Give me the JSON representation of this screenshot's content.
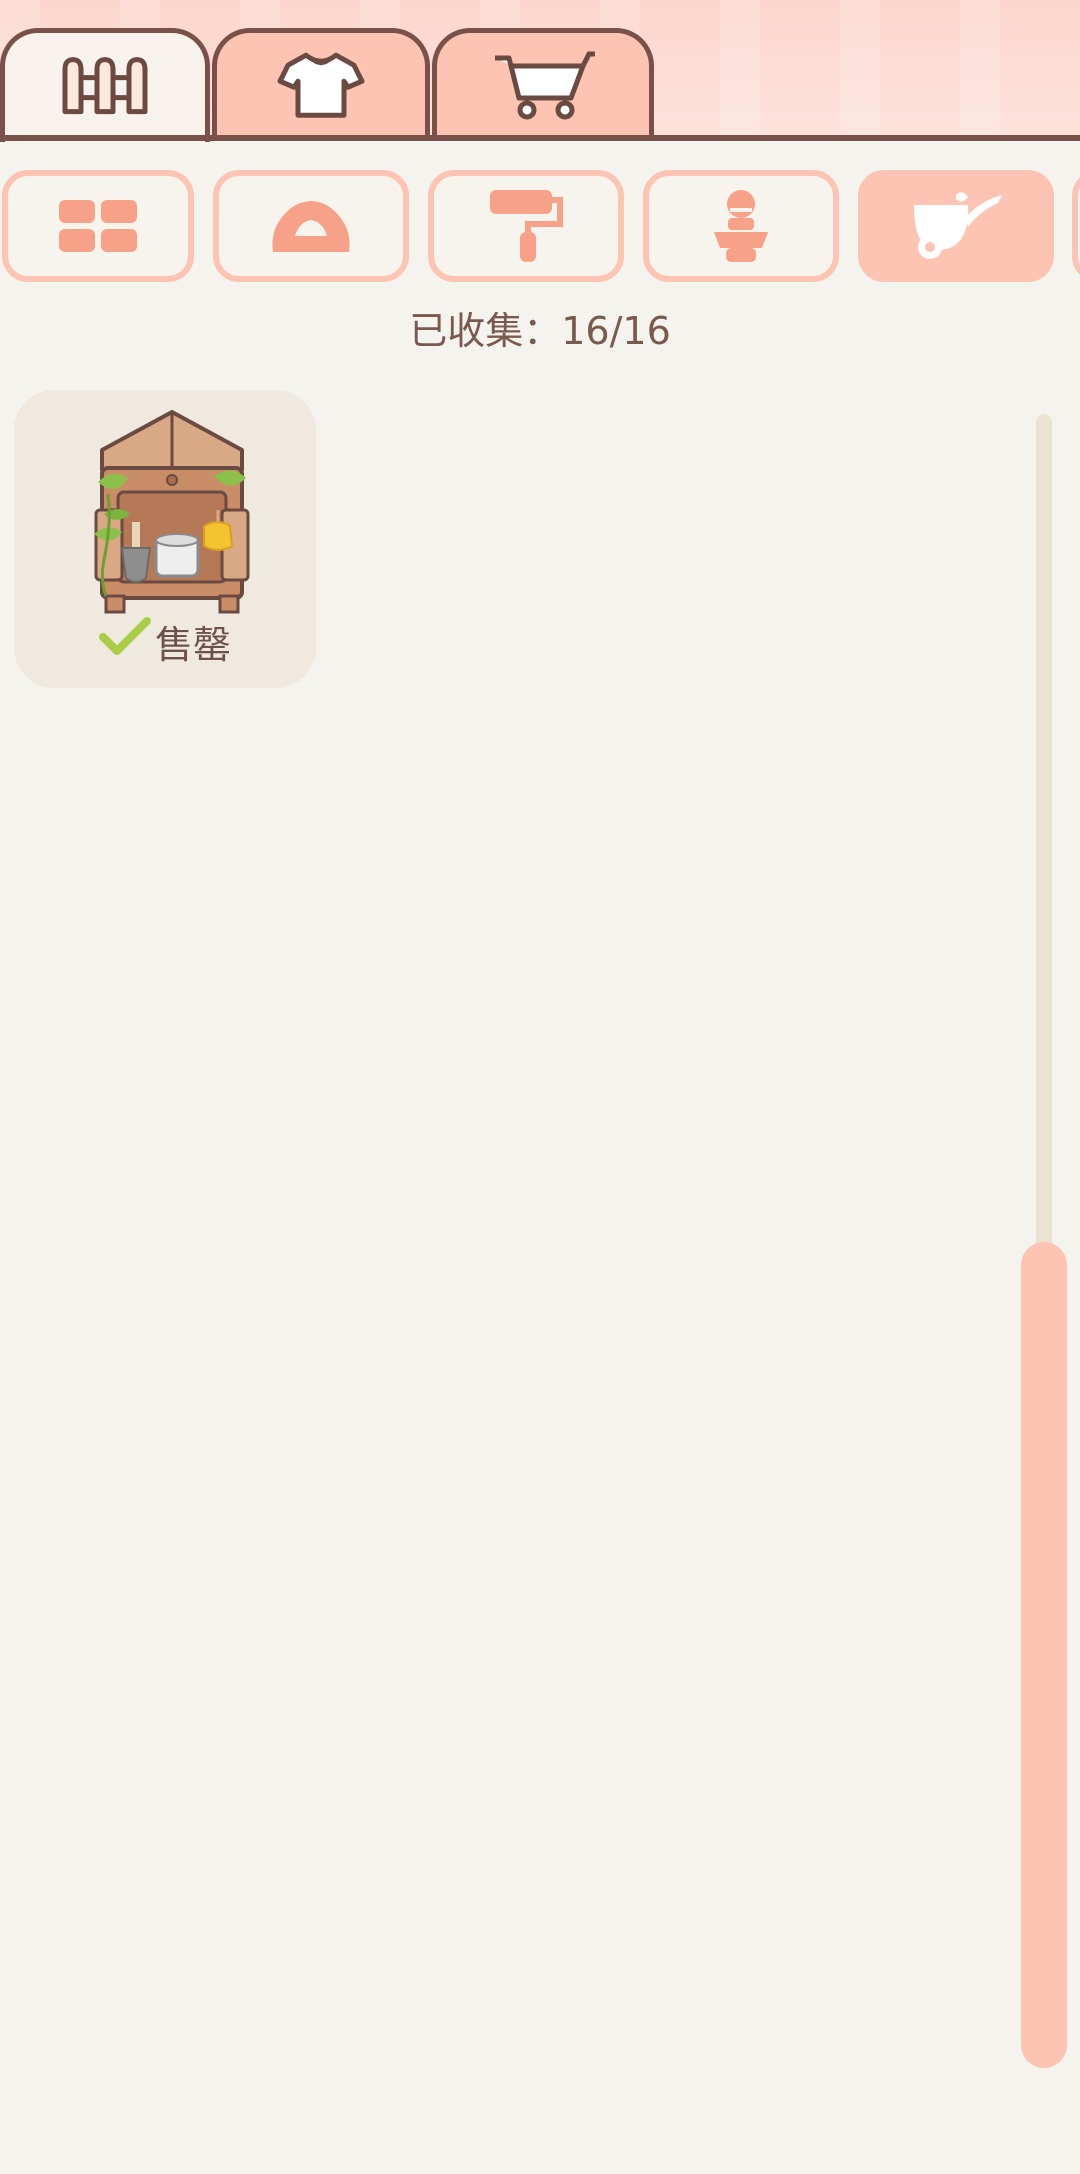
{
  "main_tabs": [
    {
      "id": "fence",
      "icon": "fence-icon",
      "active": true
    },
    {
      "id": "clothes",
      "icon": "shirt-icon",
      "active": false
    },
    {
      "id": "shop",
      "icon": "cart-icon",
      "active": false
    }
  ],
  "categories": [
    {
      "icon": "grid-icon",
      "active": false
    },
    {
      "icon": "rice-ball-icon",
      "active": false
    },
    {
      "icon": "paint-roller-icon",
      "active": false
    },
    {
      "icon": "figure-icon",
      "active": false
    },
    {
      "icon": "watering-can-icon",
      "active": true
    }
  ],
  "status": {
    "collected_text": "已收集：16/16"
  },
  "items": [
    {
      "name": "售罄",
      "status": "check-icon"
    }
  ],
  "colors": {
    "accent": "#fdc3b3",
    "outline": "#7a5149",
    "background": "#f5f3ee",
    "text": "#7a5a4f",
    "check": "#a9cd47"
  }
}
